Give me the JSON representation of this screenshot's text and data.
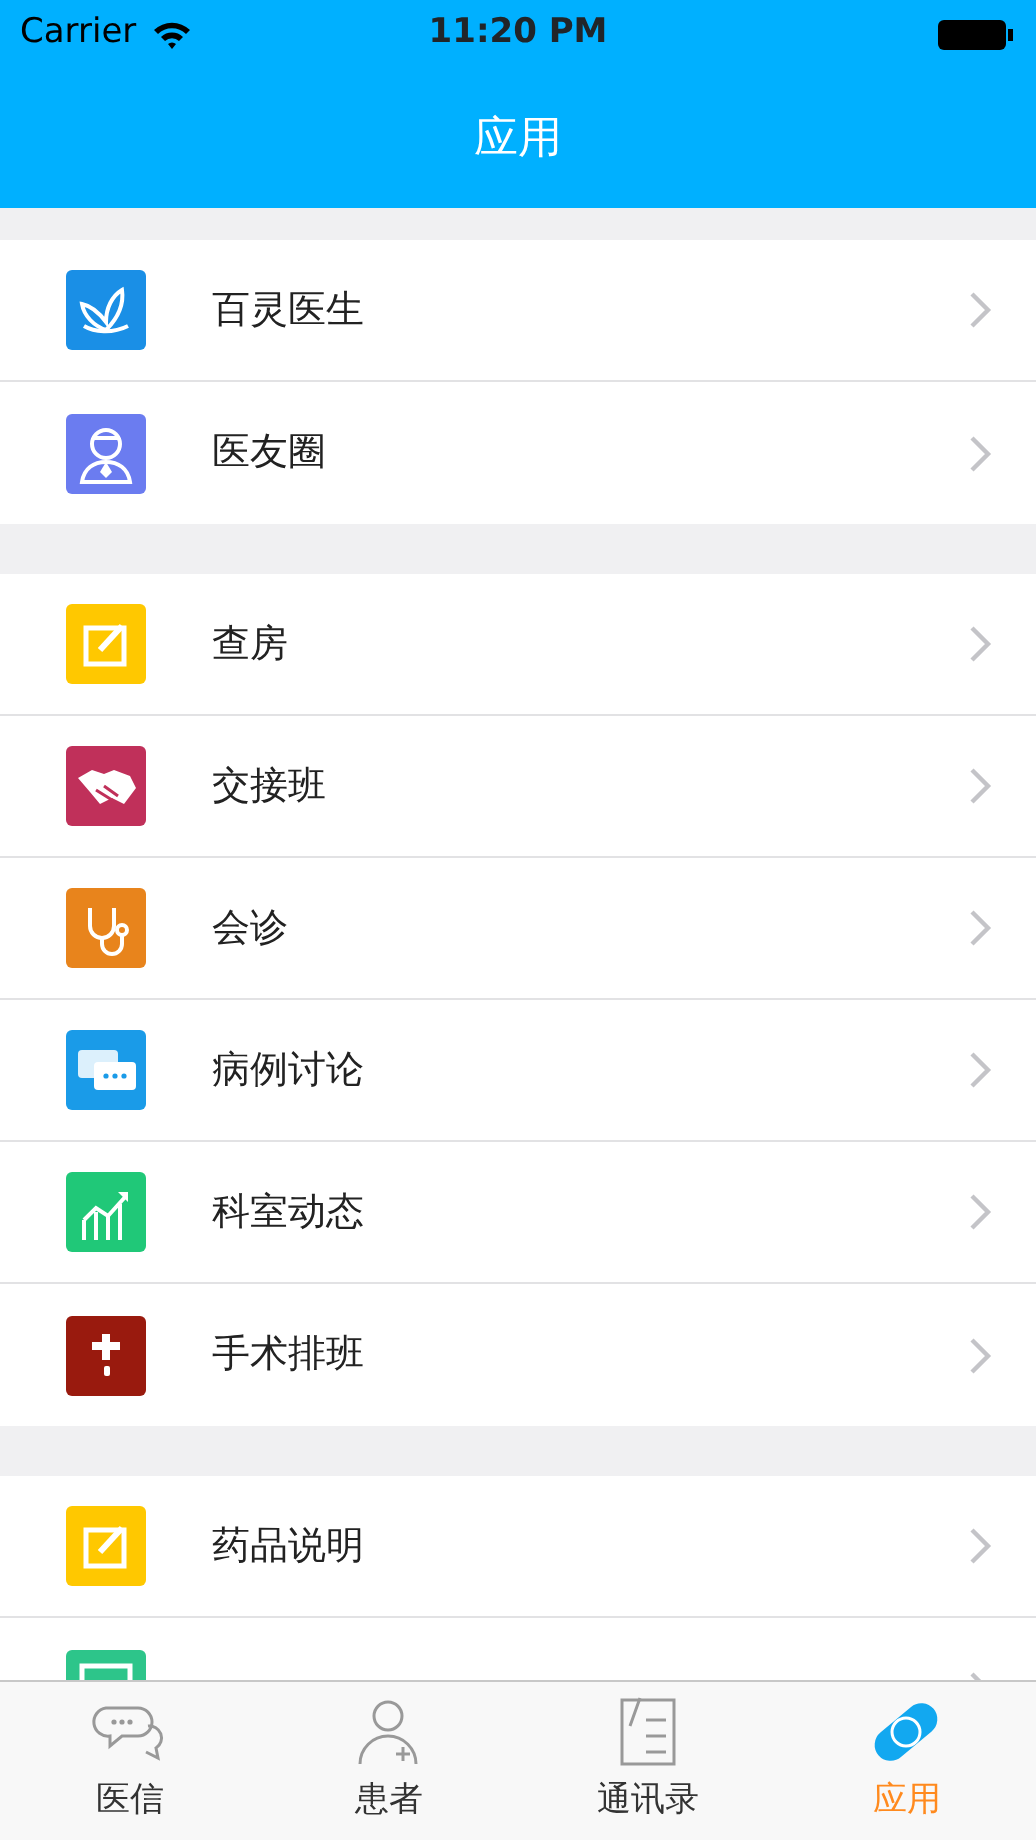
{
  "status_bar": {
    "carrier": "Carrier",
    "time": "11:20 PM"
  },
  "nav_bar": {
    "title": "应用"
  },
  "sections": [
    {
      "items": [
        {
          "label": "百灵医生",
          "kind": "butterfly",
          "color": "#1a8fe6"
        },
        {
          "label": "医友圈",
          "kind": "doctor",
          "color": "#6b7cf0"
        }
      ]
    },
    {
      "items": [
        {
          "label": "查房",
          "kind": "edit",
          "color": "#ffc800"
        },
        {
          "label": "交接班",
          "kind": "handshake",
          "color": "#c0305a"
        },
        {
          "label": "会诊",
          "kind": "stethoscope",
          "color": "#e8841c"
        },
        {
          "label": "病例讨论",
          "kind": "chat",
          "color": "#1a9be8"
        },
        {
          "label": "科室动态",
          "kind": "chart",
          "color": "#20c878"
        },
        {
          "label": "手术排班",
          "kind": "cross",
          "color": "#991a0e"
        }
      ]
    },
    {
      "items": [
        {
          "label": "药品说明",
          "kind": "edit",
          "color": "#ffc800"
        },
        {
          "kind": "calendar",
          "color": "#2dc58a"
        }
      ]
    }
  ],
  "tab_bar": [
    {
      "label": "医信",
      "kind": "chat",
      "selected": false
    },
    {
      "label": "患者",
      "kind": "person",
      "selected": false
    },
    {
      "label": "通讯录",
      "kind": "book",
      "selected": false
    },
    {
      "label": "应用",
      "kind": "pill",
      "selected": true
    }
  ]
}
